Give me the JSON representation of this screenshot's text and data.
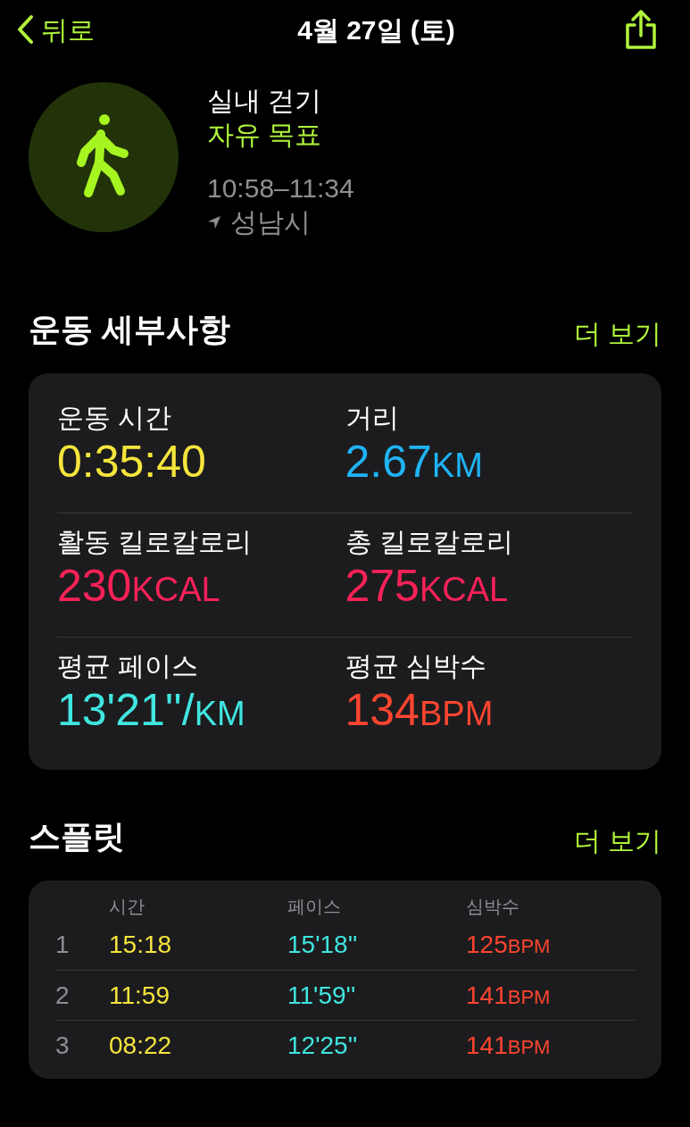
{
  "nav": {
    "back": "뒤로",
    "title": "4월 27일 (토)"
  },
  "workout": {
    "name": "실내 걷기",
    "goal": "자유 목표",
    "time_range": "10:58–11:34",
    "location": "성남시"
  },
  "details": {
    "heading": "운동 세부사항",
    "more": "더 보기",
    "metrics": [
      {
        "label": "운동 시간",
        "value": "0:35:40",
        "color": "#f5e53c"
      },
      {
        "label": "거리",
        "value": "2.67",
        "unit": "KM",
        "color": "#1fb4f5"
      },
      {
        "label": "활동 킬로칼로리",
        "value": "230",
        "unit": "KCAL",
        "color": "#fa2158"
      },
      {
        "label": "총 킬로칼로리",
        "value": "275",
        "unit": "KCAL",
        "color": "#fa2158"
      },
      {
        "label": "평균 페이스",
        "value": "13'21''/",
        "unit": "KM",
        "color": "#40e6e0"
      },
      {
        "label": "평균 심박수",
        "value": "134",
        "unit": "BPM",
        "color": "#ff4530"
      }
    ]
  },
  "splits": {
    "heading": "스플릿",
    "more": "더 보기",
    "columns": [
      "시간",
      "페이스",
      "심박수"
    ],
    "rows": [
      {
        "index": "1",
        "time": "15:18",
        "pace": "15'18''",
        "heart_rate": "125",
        "unit": "BPM"
      },
      {
        "index": "2",
        "time": "11:59",
        "pace": "11'59''",
        "heart_rate": "141",
        "unit": "BPM"
      },
      {
        "index": "3",
        "time": "08:22",
        "pace": "12'25''",
        "heart_rate": "141",
        "unit": "BPM"
      }
    ]
  }
}
